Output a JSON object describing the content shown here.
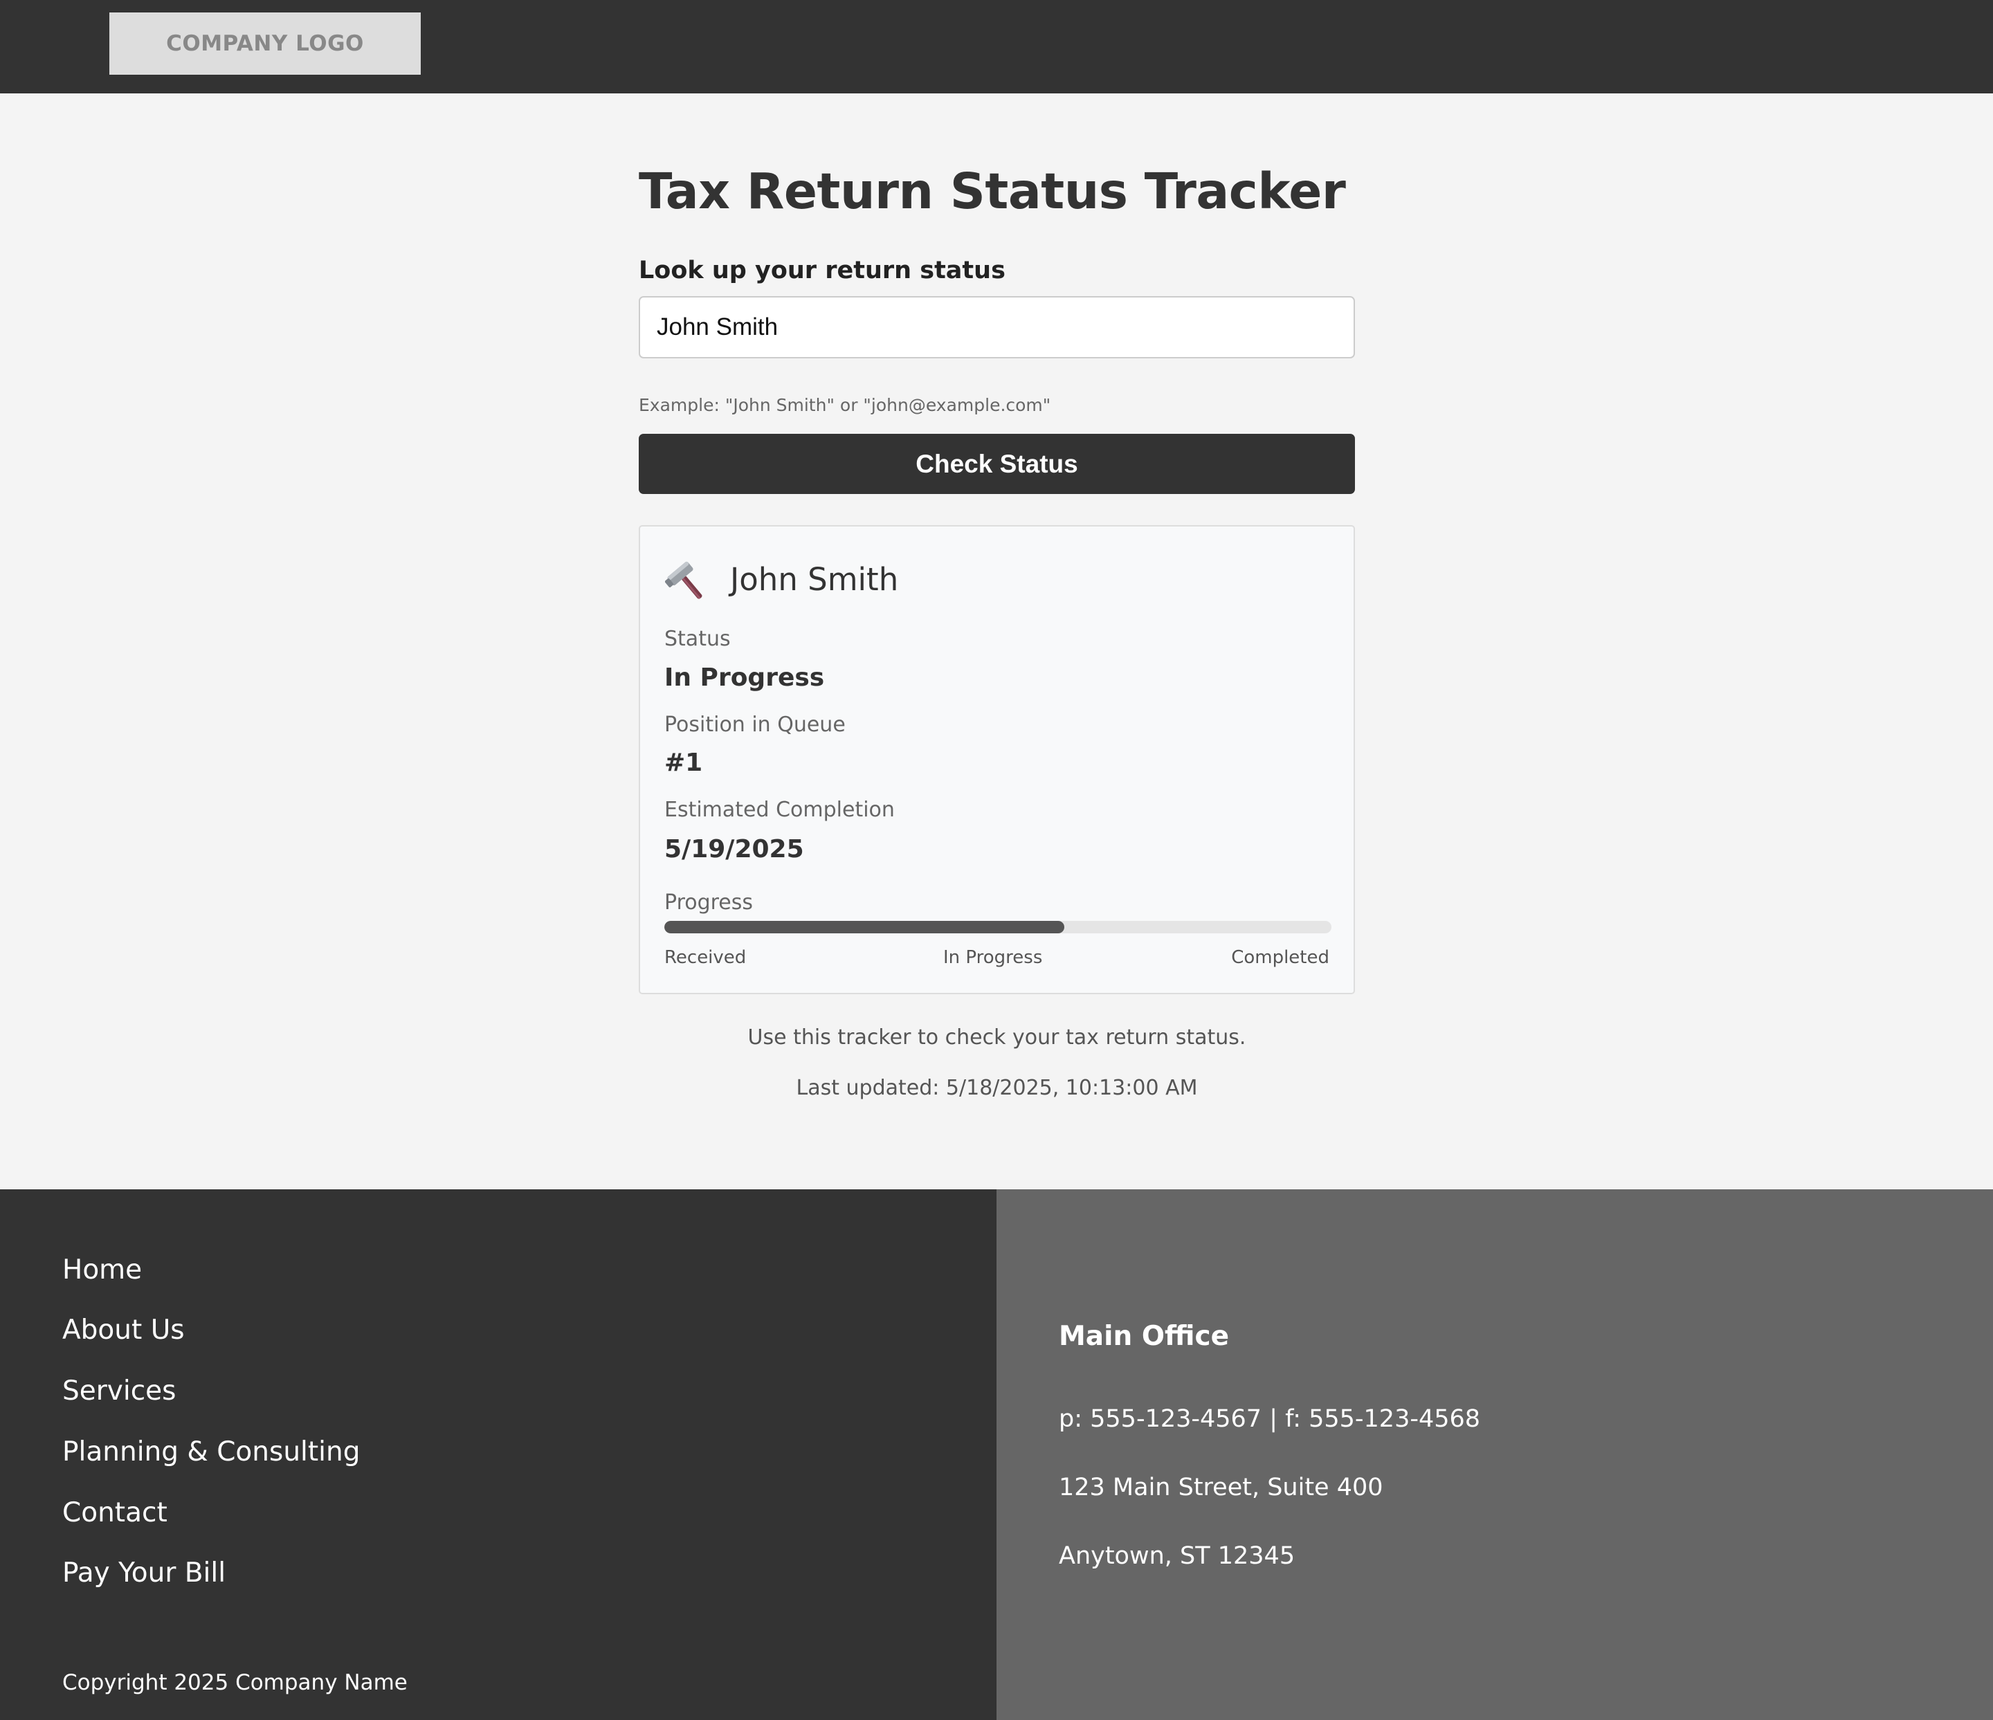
{
  "header": {
    "logo_text": "COMPANY LOGO"
  },
  "main": {
    "title": "Tax Return Status Tracker",
    "lookup_label": "Look up your return status",
    "search_value": "John Smith",
    "hint": "Example: \"John Smith\" or \"john@example.com\"",
    "check_button": "Check Status",
    "result": {
      "icon": "hammer-icon",
      "name": "John Smith",
      "status_label": "Status",
      "status_value": "In Progress",
      "queue_label": "Position in Queue",
      "queue_value": "#1",
      "completion_label": "Estimated Completion",
      "completion_value": "5/19/2025",
      "progress_label": "Progress",
      "progress_fraction": 0.6,
      "stages": [
        "Received",
        "In Progress",
        "Completed"
      ]
    },
    "info_text": "Use this tracker to check your tax return status.",
    "last_updated": "Last updated: 5/18/2025, 10:13:00 AM"
  },
  "footer": {
    "nav": [
      "Home",
      "About Us",
      "Services",
      "Planning & Consulting",
      "Contact",
      "Pay Your Bill"
    ],
    "copyright": "Copyright 2025 Company Name",
    "office": {
      "title": "Main Office",
      "phone": "p: 555-123-4567 | f: 555-123-4568",
      "address1": "123 Main Street, Suite 400",
      "address2": "Anytown, ST 12345"
    }
  },
  "colors": {
    "header_bg": "#333333",
    "footer_left_bg": "#333333",
    "footer_right_bg": "#666666",
    "button_bg": "#333333",
    "progress_fill": "#555555"
  }
}
